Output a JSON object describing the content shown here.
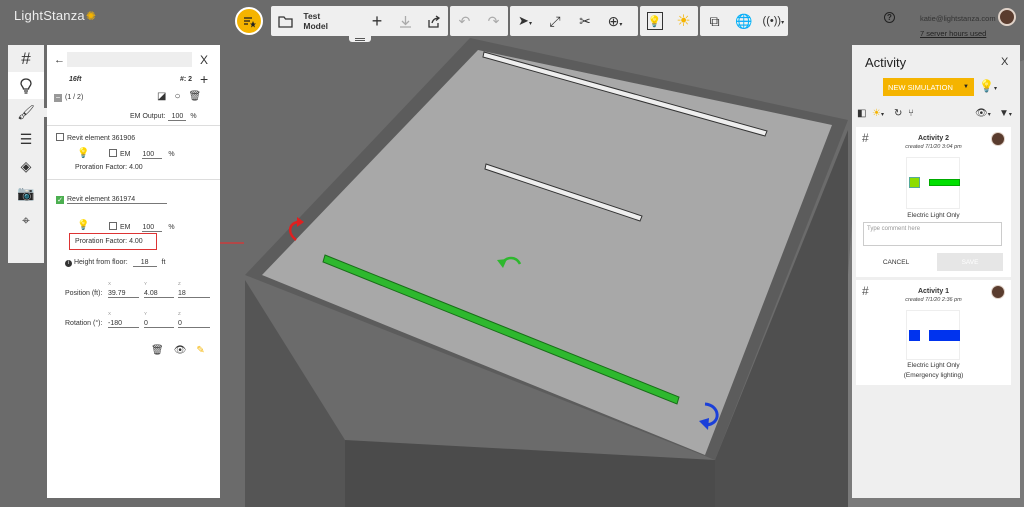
{
  "app": {
    "logo_text": "LightStanza"
  },
  "toolbar": {
    "model_name": "Test Model",
    "icons": [
      "favorites-icon",
      "folder-icon",
      "plus-icon",
      "download-icon",
      "share-icon",
      "undo-icon",
      "redo-icon",
      "pointer-icon",
      "expand-icon",
      "scissors-icon",
      "crosshair-icon",
      "lightbulb-icon",
      "sun-icon",
      "cube-icon",
      "globe-icon",
      "antenna-icon"
    ]
  },
  "user": {
    "email": "katie@lightstanza.com",
    "server_hours": "7 server hours used"
  },
  "left_tools": [
    "grid-icon",
    "lightbulb-icon",
    "paint-icon",
    "layers-lines-icon",
    "layers-icon",
    "camera-icon",
    "map-pin-icon"
  ],
  "properties": {
    "title": "16ft",
    "count_label": "#: 2",
    "selection": "(1 / 2)",
    "em_output_label": "EM Output:",
    "em_output_value": "100",
    "percent": "%",
    "elements": [
      {
        "name": "Revit element 361906",
        "checked": false,
        "em_label": "EM",
        "em_value": "100",
        "proration": "Proration Factor: 4.00"
      },
      {
        "name": "Revit element 361974",
        "checked": true,
        "em_label": "EM",
        "em_value": "100",
        "proration": "Proration Factor: 4.00",
        "height_label": "Height from floor:",
        "height_value": "18",
        "height_unit": "ft",
        "position_label": "Position (ft):",
        "position": [
          "39.79",
          "4.08",
          "18"
        ],
        "rotation_label": "Rotation (°):",
        "rotation": [
          "-180",
          "0",
          "0"
        ],
        "axis_labels": [
          "X",
          "Y",
          "Z"
        ]
      }
    ]
  },
  "activity": {
    "title": "Activity",
    "new_simulation": "NEW SIMULATION",
    "cards": [
      {
        "name": "Activity 2",
        "created": "created 7/1/20 3:04 pm",
        "label": "Electric Light Only",
        "comment_placeholder": "Type comment here",
        "cancel": "CANCEL",
        "save": "SAVE",
        "thumb_color": "#00e000"
      },
      {
        "name": "Activity 1",
        "created": "created 7/1/20 2:36 pm",
        "label": "Electric Light Only",
        "label2": "(Emergency lighting)",
        "thumb_color": "#0033ee"
      }
    ]
  },
  "colors": {
    "accent": "#f5b400",
    "selected_fixture": "#2eb82e",
    "highlight_red": "#d33333",
    "rotate_blue": "#1a3fd9"
  }
}
